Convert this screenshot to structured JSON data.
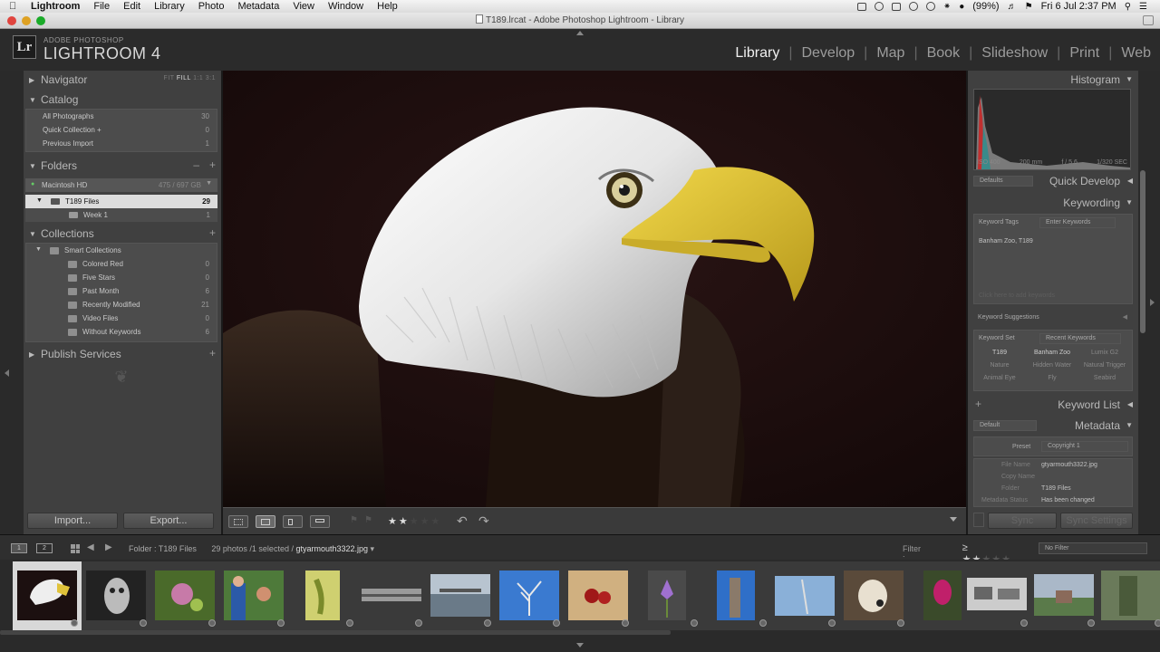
{
  "menubar": {
    "app": "Lightroom",
    "items": [
      "File",
      "Edit",
      "Library",
      "Photo",
      "Metadata",
      "View",
      "Window",
      "Help"
    ],
    "battery": "(99%)",
    "clock": "Fri 6 Jul  2:37 PM"
  },
  "window": {
    "title": "T189.lrcat - Adobe Photoshop Lightroom - Library"
  },
  "identity": {
    "logo": "Lr",
    "sub": "ADOBE PHOTOSHOP",
    "name": "LIGHTROOM 4"
  },
  "modules": [
    "Library",
    "Develop",
    "Map",
    "Book",
    "Slideshow",
    "Print",
    "Web"
  ],
  "left": {
    "navigator": {
      "label": "Navigator",
      "opts": [
        "FIT",
        "FILL",
        "1:1",
        "3:1"
      ]
    },
    "catalog": {
      "label": "Catalog",
      "items": [
        {
          "name": "All Photographs",
          "count": "30"
        },
        {
          "name": "Quick Collection +",
          "count": "0"
        },
        {
          "name": "Previous Import",
          "count": "1"
        }
      ]
    },
    "folders": {
      "label": "Folders",
      "drive": "Macintosh HD",
      "drive_info": "475 / 697 GB",
      "items": [
        {
          "name": "T189 Files",
          "count": "29"
        },
        {
          "name": "Week 1",
          "count": "1"
        }
      ]
    },
    "collections": {
      "label": "Collections",
      "group": "Smart Collections",
      "items": [
        {
          "name": "Colored Red",
          "count": "0"
        },
        {
          "name": "Five Stars",
          "count": "0"
        },
        {
          "name": "Past Month",
          "count": "6"
        },
        {
          "name": "Recently Modified",
          "count": "21"
        },
        {
          "name": "Video Files",
          "count": "0"
        },
        {
          "name": "Without Keywords",
          "count": "6"
        }
      ]
    },
    "publish": {
      "label": "Publish Services"
    },
    "import_label": "Import...",
    "export_label": "Export..."
  },
  "toolbar": {
    "rating_on": "★★",
    "rating_off": "★★★"
  },
  "right": {
    "histogram": {
      "label": "Histogram",
      "iso": "ISO 400",
      "focal": "200 mm",
      "fstop": "f / 5.6",
      "shutter": "1/320 SEC"
    },
    "quick_develop": {
      "preset": "Defaults",
      "label": "Quick Develop"
    },
    "keywording": {
      "label": "Keywording",
      "tags_label": "Keyword Tags",
      "tags_mode": "Enter Keywords",
      "keywords": "Banham Zoo, T189",
      "hint": "Click here to add keywords",
      "suggestions_label": "Keyword Suggestions",
      "set_label": "Keyword Set",
      "set_value": "Recent Keywords",
      "set_items": [
        "T189",
        "Banham Zoo",
        "Lumix G2",
        "Nature",
        "Hidden Water",
        "Natural Trigger",
        "Animal Eye",
        "Fly",
        "Seabird"
      ]
    },
    "keyword_list": {
      "label": "Keyword List"
    },
    "metadata": {
      "preset": "Default",
      "label": "Metadata",
      "preset_label": "Preset",
      "preset_value": "Copyright 1",
      "fields": [
        {
          "k": "File Name",
          "v": "gtyarmouth3322.jpg"
        },
        {
          "k": "Copy Name",
          "v": ""
        },
        {
          "k": "Folder",
          "v": "T189 Files"
        },
        {
          "k": "Metadata Status",
          "v": "Has been changed"
        }
      ]
    }
  },
  "filmstrip_header": {
    "monitor1": "1",
    "monitor2": "2",
    "path_prefix": "Folder : T189 Files",
    "count": "29 photos /1 selected /",
    "filename": "gtyarmouth3322.jpg",
    "filter_label": "Filter :",
    "filter_value": "No Filter"
  },
  "colors": {
    "panel": "#404040",
    "accent_text": "#f0f0f0",
    "selection": "#dcdcdc"
  }
}
